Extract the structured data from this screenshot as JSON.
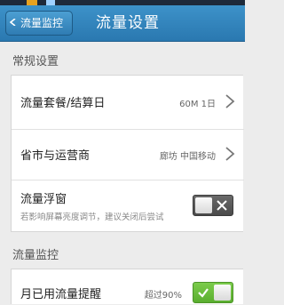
{
  "header": {
    "back_label": "流量监控",
    "title": "流量设置"
  },
  "sections": [
    {
      "title": "常规设置",
      "rows": [
        {
          "label": "流量套餐/结算日",
          "value": "60M 1日"
        },
        {
          "label": "省市与运营商",
          "value": "廊坊 中国移动"
        },
        {
          "label": "流量浮窗",
          "subtext": "若影响屏幕亮度调节，建议关闭后尝试",
          "toggle_on": false
        }
      ]
    },
    {
      "title": "流量监控",
      "rows": [
        {
          "label": "月已用流量提醒",
          "value": "超过90%",
          "toggle_on": true
        }
      ]
    }
  ],
  "colors": {
    "titlebar": "#2f80b8",
    "toggle_on": "#6cbf3d",
    "toggle_off": "#555555"
  }
}
